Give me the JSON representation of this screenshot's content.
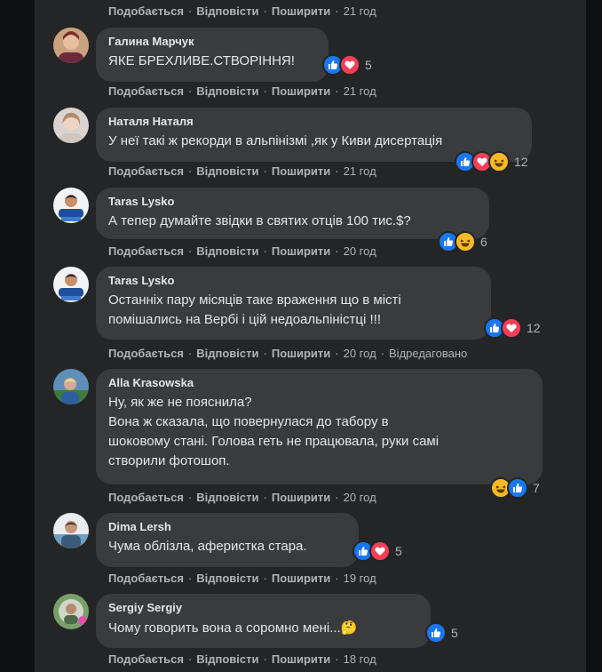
{
  "comments": [
    {
      "author": "",
      "text": "",
      "actions": {
        "like": "Подобається",
        "reply": "Відповісти",
        "share": "Поширити",
        "time": "21 год"
      }
    },
    {
      "author": "Галина Марчук",
      "text": "ЯКЕ БРЕХЛИВЕ.СТВОРІННЯ!",
      "reaction_count": "5",
      "reactions": [
        "like-icon",
        "love-icon"
      ],
      "actions": {
        "like": "Подобається",
        "reply": "Відповісти",
        "share": "Поширити",
        "time": "21 год"
      }
    },
    {
      "author": "Наталя Наталя",
      "text": "У неї такі ж рекорди в альпінізмі ,як у Киви дисертація",
      "reaction_count": "12",
      "reactions": [
        "like-icon",
        "love-icon",
        "haha-icon"
      ],
      "actions": {
        "like": "Подобається",
        "reply": "Відповісти",
        "share": "Поширити",
        "time": "21 год"
      }
    },
    {
      "author": "Taras Lysko",
      "text": "А тепер думайте звідки в святих отців 100 тис.$?",
      "reaction_count": "6",
      "reactions": [
        "like-icon",
        "haha-icon"
      ],
      "actions": {
        "like": "Подобається",
        "reply": "Відповісти",
        "share": "Поширити",
        "time": "20 год"
      }
    },
    {
      "author": "Taras Lysko",
      "text_lines": [
        "Останніх пару місяців таке враження що в місті",
        "помішались на Вербі і цій недоальпіністці !!!"
      ],
      "reaction_count": "12",
      "reactions": [
        "like-icon",
        "love-icon"
      ],
      "actions": {
        "like": "Подобається",
        "reply": "Відповісти",
        "share": "Поширити",
        "time": "20 год",
        "edited": "Відредаговано"
      }
    },
    {
      "author": "Alla Krasowska",
      "text_lines": [
        "Ну, як же не пояснила?",
        "Вона ж сказала, що повернулася до табору в",
        "шоковому стані. Голова геть не працювала, руки самі",
        "створили фотошоп."
      ],
      "reaction_count": "7",
      "reactions": [
        "haha-icon",
        "like-icon"
      ],
      "actions": {
        "like": "Подобається",
        "reply": "Відповісти",
        "share": "Поширити",
        "time": "20 год"
      }
    },
    {
      "author": "Dima Lersh",
      "text": "Чума облізла, аферистка стара.",
      "reaction_count": "5",
      "reactions": [
        "like-icon",
        "love-icon"
      ],
      "actions": {
        "like": "Подобається",
        "reply": "Відповісти",
        "share": "Поширити",
        "time": "19 год"
      }
    },
    {
      "author": "Sergiy Sergiy",
      "text": "Чому говорить вона а соромно мені...",
      "emoji": "🤔",
      "reaction_count": "5",
      "reactions": [
        "like-icon"
      ],
      "actions": {
        "like": "Подобається",
        "reply": "Відповісти",
        "share": "Поширити",
        "time": "18 год"
      }
    }
  ],
  "colors": {
    "bubble": "#3a3b3c",
    "panel": "#242526",
    "like": "#1877f2",
    "love": "#f33e58",
    "haha": "#f7b928"
  }
}
